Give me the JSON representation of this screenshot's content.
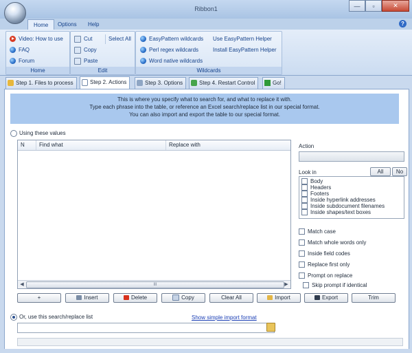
{
  "window": {
    "title": "Ribbon1",
    "controls": [
      "—",
      "▫",
      "✕"
    ]
  },
  "ribbon_tabs": [
    "Home",
    "Options",
    "Help"
  ],
  "help_label": "?",
  "groups": {
    "home": {
      "label": "Home",
      "items": [
        "Video: How to use",
        "FAQ",
        "Forum"
      ]
    },
    "edit": {
      "label": "Edit",
      "cut": "Cut",
      "copy": "Copy",
      "paste": "Paste",
      "select_all": "Select All"
    },
    "wildcards": {
      "label": "Wildcards",
      "items": [
        "EasyPattern wildcards",
        "Perl regex wildcards",
        "Word native wildcards"
      ],
      "helpers": [
        "Use EasyPattern Helper",
        "Install EasyPattern Helper"
      ]
    }
  },
  "step_tabs": [
    "Step 1. Files to process",
    "Step 2. Actions",
    "Step 3. Options",
    "Step 4. Restart Control",
    "Go!"
  ],
  "info_lines": [
    "This is where you specify what to search for, and what to replace it with.",
    "Type each phrase into the table, or reference an Excel search/replace list in our special format.",
    "You can also import and export the table to our special format."
  ],
  "using_values_label": "Using these values",
  "table": {
    "columns": [
      "N",
      "Find what",
      "Replace with"
    ],
    "scroll_grip": "III"
  },
  "side": {
    "action_label": "Action",
    "lookin_label": "Look in",
    "all_button": "All",
    "none_button": "No",
    "lookin_items": [
      "Body",
      "Headers",
      "Footers",
      "Inside hyperlink addresses",
      "Inside subdocument filenames",
      "Inside shapes/text boxes"
    ],
    "options": [
      "Match case",
      "Match whole words only",
      "Inside field codes",
      "Replace first only",
      "Prompt on replace"
    ],
    "skip_prompt": "Skip prompt if identical"
  },
  "buttons": {
    "add": "+",
    "insert": "Insert",
    "delete": "Delete",
    "copy": "Copy",
    "clear_all": "Clear All",
    "import": "Import",
    "export": "Export",
    "trim": "Trim"
  },
  "list_radio_label": "Or, use this search/replace list",
  "import_format_link": "Show simple import format",
  "colors": {
    "ribbon": "#dbe7f6",
    "info_bar": "#a9c8ee",
    "link": "#1b3fb5"
  }
}
